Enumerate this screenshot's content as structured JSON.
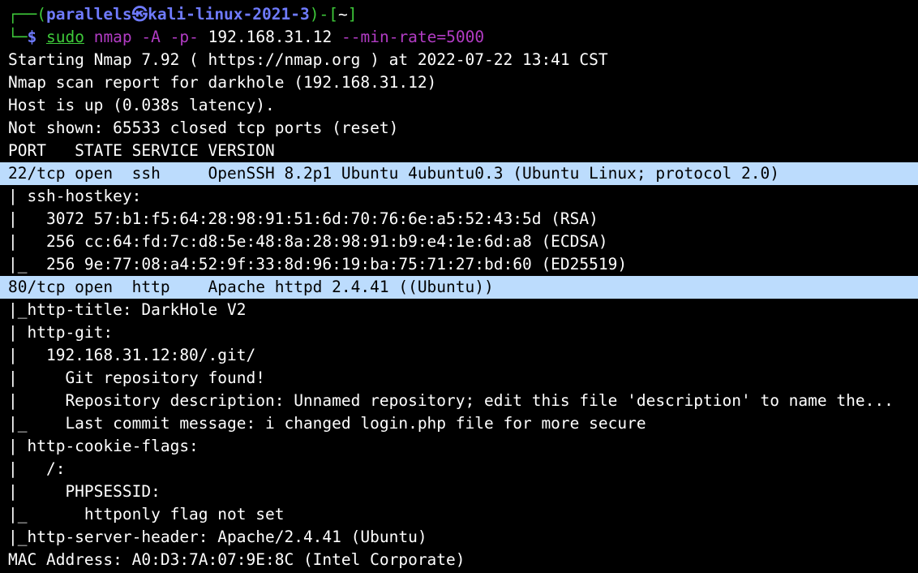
{
  "prompt": {
    "corner_top": "┌──(",
    "user": "parallels㉿",
    "host": "kali-linux-2021-3",
    "close_paren": ")-[",
    "cwd": "~",
    "close_bracket": "]",
    "corner_bottom": "└─",
    "dollar": "$",
    "cmd": "sudo",
    "args1": "nmap",
    "args2": "-A -p-",
    "target": "192.168.31.12",
    "flag": "--min-rate=5000"
  },
  "output": [
    {
      "text": "Starting Nmap 7.92 ( https://nmap.org ) at 2022-07-22 13:41 CST",
      "hl": false
    },
    {
      "text": "Nmap scan report for darkhole (192.168.31.12)",
      "hl": false
    },
    {
      "text": "Host is up (0.038s latency).",
      "hl": false
    },
    {
      "text": "Not shown: 65533 closed tcp ports (reset)",
      "hl": false
    },
    {
      "text": "PORT   STATE SERVICE VERSION",
      "hl": false
    },
    {
      "text": "22/tcp open  ssh     OpenSSH 8.2p1 Ubuntu 4ubuntu0.3 (Ubuntu Linux; protocol 2.0)",
      "hl": true
    },
    {
      "text": "| ssh-hostkey: ",
      "hl": false
    },
    {
      "text": "|   3072 57:b1:f5:64:28:98:91:51:6d:70:76:6e:a5:52:43:5d (RSA)",
      "hl": false
    },
    {
      "text": "|   256 cc:64:fd:7c:d8:5e:48:8a:28:98:91:b9:e4:1e:6d:a8 (ECDSA)",
      "hl": false
    },
    {
      "text": "|_  256 9e:77:08:a4:52:9f:33:8d:96:19:ba:75:71:27:bd:60 (ED25519)",
      "hl": false
    },
    {
      "text": "80/tcp open  http    Apache httpd 2.4.41 ((Ubuntu))",
      "hl": true
    },
    {
      "text": "|_http-title: DarkHole V2",
      "hl": false
    },
    {
      "text": "| http-git: ",
      "hl": false
    },
    {
      "text": "|   192.168.31.12:80/.git/",
      "hl": false
    },
    {
      "text": "|     Git repository found!",
      "hl": false
    },
    {
      "text": "|     Repository description: Unnamed repository; edit this file 'description' to name the...",
      "hl": false
    },
    {
      "text": "|_    Last commit message: i changed login.php file for more secure ",
      "hl": false
    },
    {
      "text": "| http-cookie-flags: ",
      "hl": false
    },
    {
      "text": "|   /: ",
      "hl": false
    },
    {
      "text": "|     PHPSESSID: ",
      "hl": false
    },
    {
      "text": "|_      httponly flag not set",
      "hl": false
    },
    {
      "text": "|_http-server-header: Apache/2.4.41 (Ubuntu)",
      "hl": false
    },
    {
      "text": "MAC Address: A0:D3:7A:07:9E:8C (Intel Corporate)",
      "hl": false
    }
  ],
  "colors": {
    "background": "#000000",
    "highlight": "#bcdcfd",
    "prompt_green": "#3ec93a",
    "prompt_blue": "#6f7bff",
    "command_purple": "#b23cc4"
  }
}
